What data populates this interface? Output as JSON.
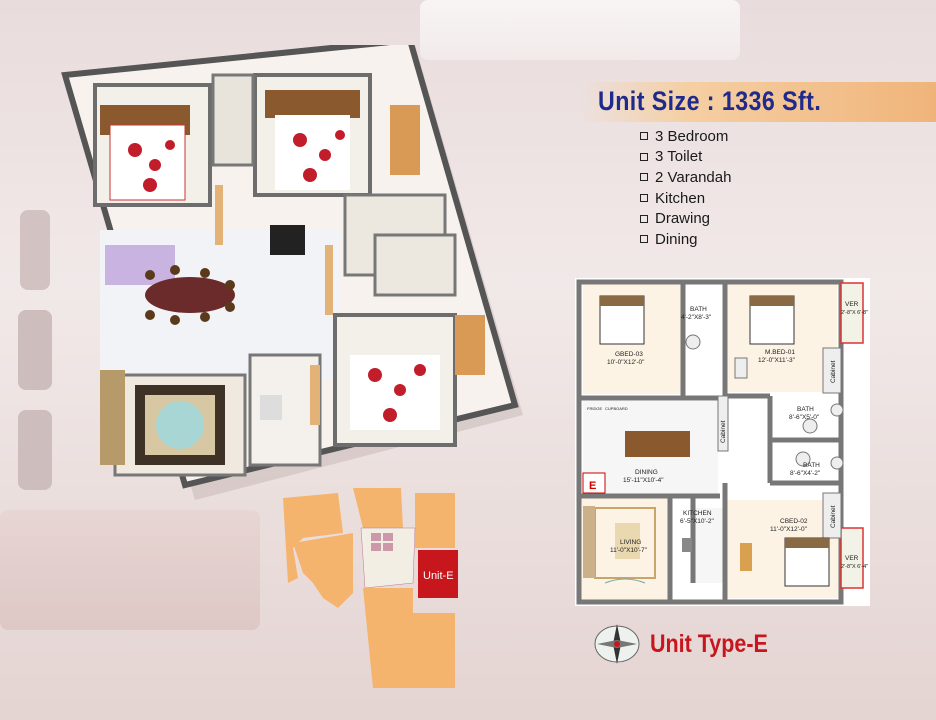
{
  "header": {
    "unit_size": "Unit Size : 1336 Sft."
  },
  "features": [
    "3 Bedroom",
    "3 Toilet",
    "2 Varandah",
    "Kitchen",
    "Drawing",
    "Dining"
  ],
  "plan_labels": {
    "gbed": "GBED-03",
    "gbed_size": "10'-0\"X12'-0\"",
    "bath1": "BATH",
    "bath1_size": "4'-2\"X8'-3\"",
    "mbed": "M.BED-01",
    "mbed_size": "12'-0\"X11'-3\"",
    "ver1": "VER",
    "ver1_size": "2'-8\"X 6'-8\"",
    "cabinet": "Cabinet",
    "bath2": "BATH",
    "bath2_size": "8'-6\"X5'-0\"",
    "bath3": "BATH",
    "bath3_size": "8'-6\"X4'-2\"",
    "dining": "DINING",
    "dining_size": "15'-11\"X10'-4\"",
    "fridge": "FRIDGE",
    "cupboard": "CUPBOARD",
    "entry": "E",
    "kitchen": "KITCHEN",
    "kitchen_size": "6'-5\"X10'-2\"",
    "cbed": "CBED-02",
    "cbed_size": "11'-0\"X12'-0\"",
    "living": "LIVING",
    "living_size": "11'-0\"X10'-7\"",
    "ver2": "VER",
    "ver2_size": "2'-8\"X 6'-4\""
  },
  "keyplan": {
    "unit_label": "Unit-E"
  },
  "footer": {
    "unit_type": "Unit Type-E"
  },
  "colors": {
    "title_blue": "#1e2a8c",
    "type_red": "#c8161d",
    "keyplan_orange": "#f5b46e",
    "wall_gray": "#777777"
  }
}
